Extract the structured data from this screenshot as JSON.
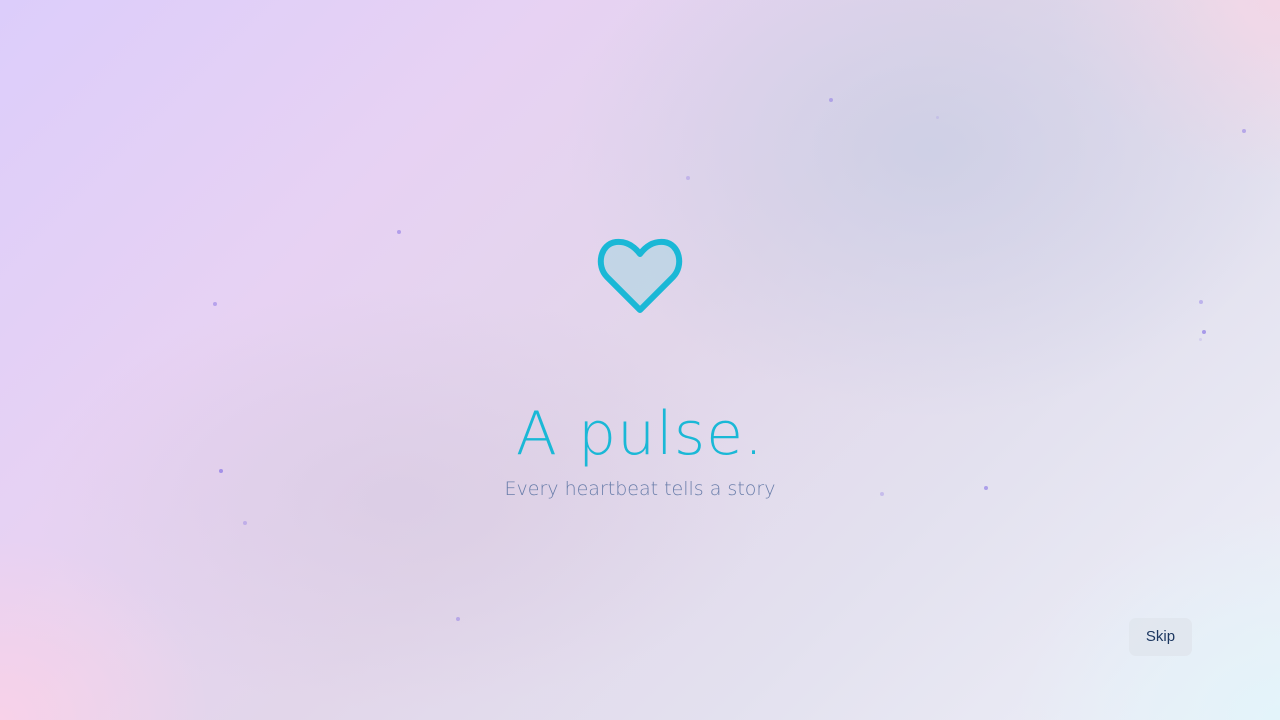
{
  "hero": {
    "title": "A pulse.",
    "subtitle": "Every heartbeat tells a story",
    "icon": "heart-outline-icon"
  },
  "controls": {
    "skip_label": "Skip"
  },
  "colors": {
    "accent": "#1ab8d6",
    "subtitle": "#6a7eaa",
    "particle": "#8f7be6",
    "button_bg": "#e1e6ee",
    "button_text": "#1c3760"
  }
}
